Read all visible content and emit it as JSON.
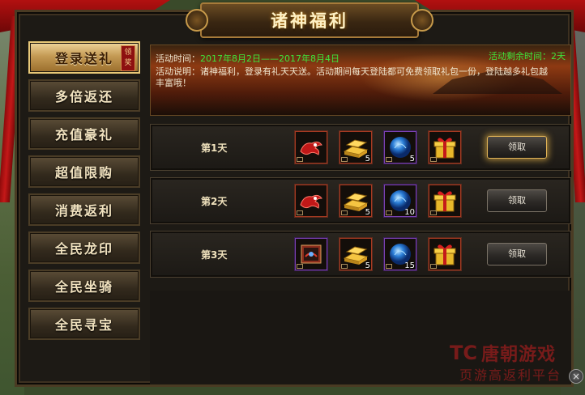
{
  "window": {
    "title": "诸神福利",
    "close_icon": "×"
  },
  "sidebar": {
    "items": [
      {
        "label": "登录送礼",
        "badge": "领奖",
        "active": true
      },
      {
        "label": "多倍返还",
        "active": false
      },
      {
        "label": "充值豪礼",
        "active": false
      },
      {
        "label": "超值限购",
        "active": false
      },
      {
        "label": "消费返利",
        "active": false
      },
      {
        "label": "全民龙印",
        "active": false
      },
      {
        "label": "全民坐骑",
        "active": false
      },
      {
        "label": "全民寻宝",
        "active": false
      }
    ]
  },
  "banner": {
    "time_label": "活动时间：",
    "time_value": "2017年8月2日——2017年8月4日",
    "remain_label": "活动剩余时间：",
    "remain_value": "2天",
    "desc": "活动说明：诸神福利，登录有礼天天送。活动期间每天登陆都可免费领取礼包一份，登陆越多礼包越丰富哦！"
  },
  "rewards": [
    {
      "day": "第1天",
      "button": "领取",
      "items": [
        {
          "icon": "red-dragon-icon",
          "count": ""
        },
        {
          "icon": "gold-bars-icon",
          "count": "5"
        },
        {
          "icon": "blue-orb-icon",
          "count": "5"
        },
        {
          "icon": "gift-box-icon",
          "count": ""
        }
      ]
    },
    {
      "day": "第2天",
      "button": "领取",
      "items": [
        {
          "icon": "red-dragon-icon",
          "count": ""
        },
        {
          "icon": "gold-bars-icon",
          "count": "5"
        },
        {
          "icon": "blue-orb-icon",
          "count": "10"
        },
        {
          "icon": "gift-box-icon",
          "count": ""
        }
      ]
    },
    {
      "day": "第3天",
      "button": "领取",
      "items": [
        {
          "icon": "scroll-icon",
          "count": ""
        },
        {
          "icon": "gold-bars-icon",
          "count": "5"
        },
        {
          "icon": "blue-orb-icon",
          "count": "15"
        },
        {
          "icon": "gift-box-icon",
          "count": ""
        }
      ]
    }
  ],
  "watermark": {
    "logo": "TC",
    "name": "唐朝游戏",
    "sub": "页游高返利平台"
  },
  "colors": {
    "accent_green": "#3ee53b",
    "tab_active": "#c49a54",
    "frame": "#4a3b23"
  }
}
